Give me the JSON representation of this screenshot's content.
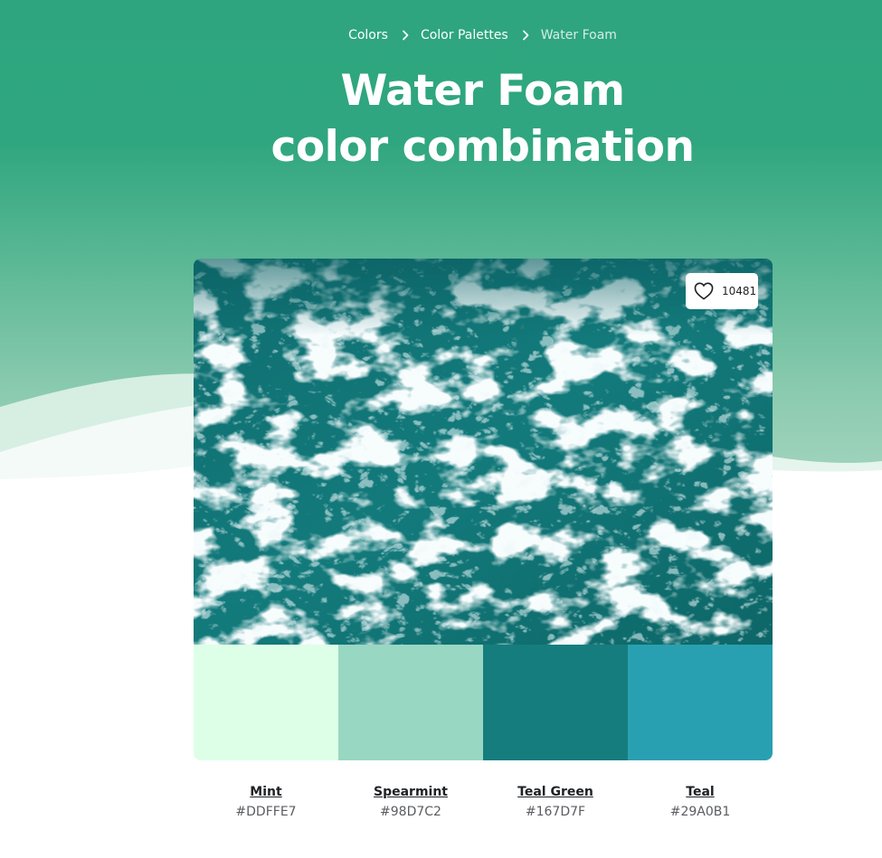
{
  "breadcrumb": {
    "items": [
      "Colors",
      "Color Palettes"
    ],
    "current": "Water Foam"
  },
  "title": {
    "line1": "Water Foam",
    "line2": "color combination"
  },
  "like": {
    "count": "10481",
    "icon": "heart-outline-icon"
  },
  "palette": [
    {
      "name": "Mint",
      "hex": "#DDFFE7",
      "color": "#DDFFE7"
    },
    {
      "name": "Spearmint",
      "hex": "#98D7C2",
      "color": "#98D7C2"
    },
    {
      "name": "Teal Green",
      "hex": "#167D7F",
      "color": "#167D7F"
    },
    {
      "name": "Teal",
      "hex": "#29A0B1",
      "color": "#29A0B1"
    }
  ],
  "colors": {
    "hero_top": "#2ea57e",
    "hero_bottom": "#a8d6c1",
    "water_dark": "#0d6a6b",
    "foam": "#e8f6f7"
  }
}
